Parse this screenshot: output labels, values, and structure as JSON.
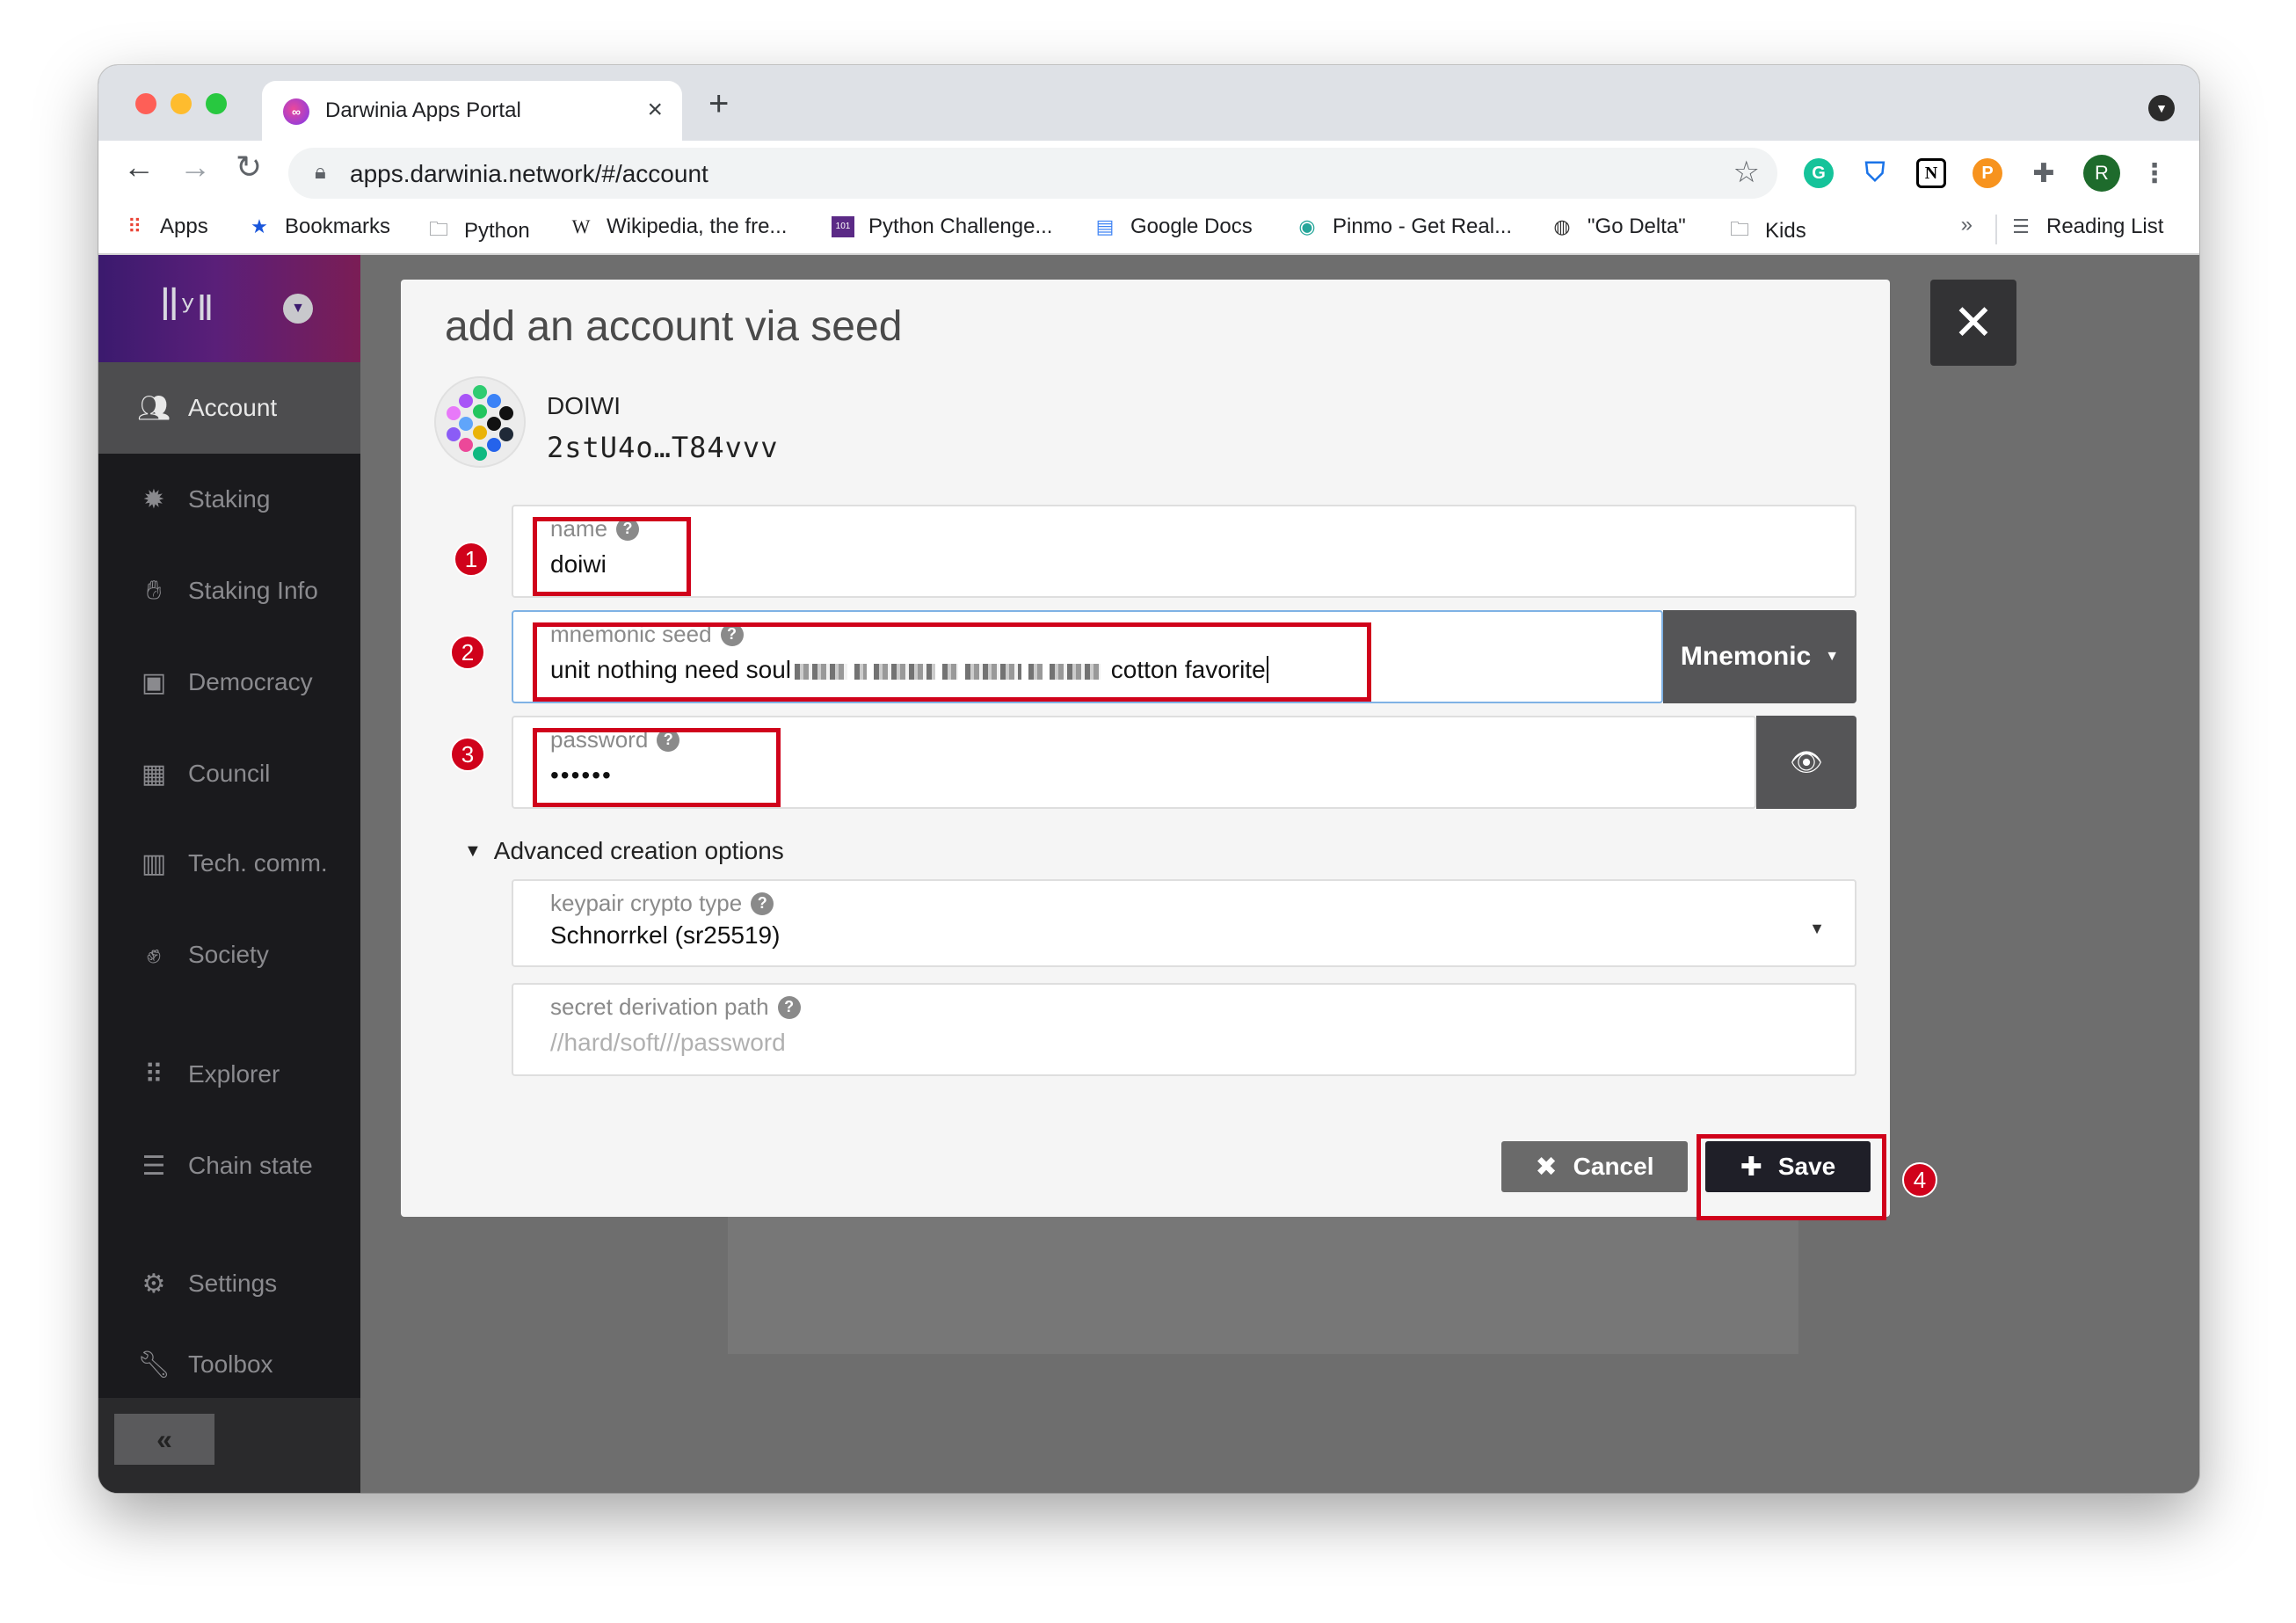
{
  "browser": {
    "tab_title": "Darwinia Apps Portal",
    "tab_close": "×",
    "new_tab": "+",
    "url": "apps.darwinia.network/#/account",
    "profile_initial": "R"
  },
  "bookmarks": [
    {
      "label": "Apps",
      "icon": "apps-grid-icon"
    },
    {
      "label": "Bookmarks",
      "icon": "star-icon"
    },
    {
      "label": "Python",
      "icon": "folder-icon"
    },
    {
      "label": "Wikipedia, the fre...",
      "icon": "wikipedia-icon"
    },
    {
      "label": "Python Challenge...",
      "icon": "python-challenge-icon"
    },
    {
      "label": "Google Docs",
      "icon": "google-docs-icon"
    },
    {
      "label": "Pinmo - Get Real...",
      "icon": "pinmo-icon"
    },
    {
      "label": "\"Go Delta\"",
      "icon": "globe-icon"
    },
    {
      "label": "Kids",
      "icon": "folder-icon"
    }
  ],
  "bookmarks_overflow": "»",
  "reading_list": "Reading List",
  "sidebar": {
    "items": [
      {
        "label": "Account",
        "icon": "users-icon"
      },
      {
        "label": "Staking",
        "icon": "certificate-icon"
      },
      {
        "label": "Staking Info",
        "icon": "hand-icon"
      },
      {
        "label": "Democracy",
        "icon": "calendar-check-icon"
      },
      {
        "label": "Council",
        "icon": "building-icon"
      },
      {
        "label": "Tech. comm.",
        "icon": "microchip-icon"
      },
      {
        "label": "Society",
        "icon": "hand-paper-icon"
      },
      {
        "label": "Explorer",
        "icon": "braille-icon"
      },
      {
        "label": "Chain state",
        "icon": "database-icon"
      },
      {
        "label": "Settings",
        "icon": "cogs-icon"
      },
      {
        "label": "Toolbox",
        "icon": "wrench-icon"
      }
    ],
    "collapse_label": "«"
  },
  "modal": {
    "title": "add an account via seed",
    "account_name": "DOIWI",
    "account_address": "2stU4o…T84vvv",
    "fields": {
      "name": {
        "label": "name",
        "value": "doiwi"
      },
      "mnemonic": {
        "label": "mnemonic seed",
        "value_start": "unit nothing need soul",
        "value_end": "cotton favorite"
      },
      "mnemonic_type": "Mnemonic",
      "password": {
        "label": "password",
        "value": "••••••"
      },
      "advanced_toggle": "Advanced creation options",
      "crypto_type": {
        "label": "keypair crypto type",
        "value": "Schnorrkel (sr25519)"
      },
      "derivation": {
        "label": "secret derivation path",
        "placeholder": "//hard/soft///password"
      }
    },
    "buttons": {
      "cancel": "Cancel",
      "save": "Save"
    },
    "help_glyph": "?"
  },
  "annotations": [
    "1",
    "2",
    "3",
    "4"
  ],
  "colors": {
    "annotation_red": "#d0021b",
    "sidebar_bg": "#1a1a1d",
    "save_button": "#1f1f28"
  }
}
